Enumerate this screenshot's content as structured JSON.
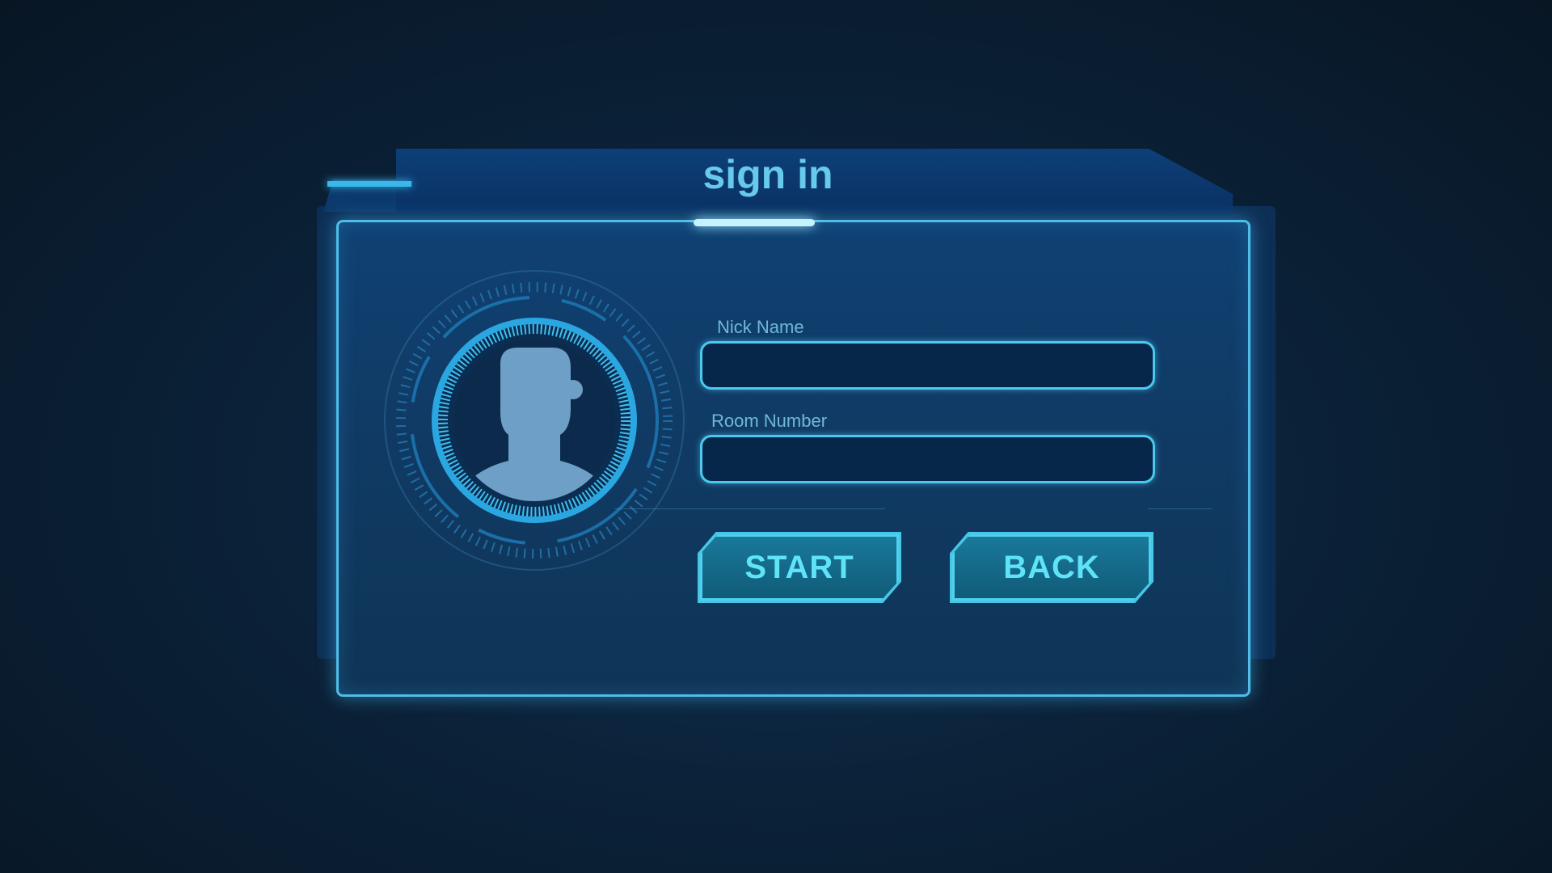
{
  "title": "sign in",
  "form": {
    "nickname": {
      "label": "Nick Name",
      "value": "",
      "placeholder": ""
    },
    "room_number": {
      "label": "Room Number",
      "value": "",
      "placeholder": ""
    }
  },
  "buttons": {
    "start": "START",
    "back": "BACK"
  },
  "avatar": {
    "icon": "user-silhouette-icon"
  },
  "colors": {
    "accent": "#4fbde8",
    "button_text": "#5fe3f7",
    "panel": "#0f4173"
  }
}
